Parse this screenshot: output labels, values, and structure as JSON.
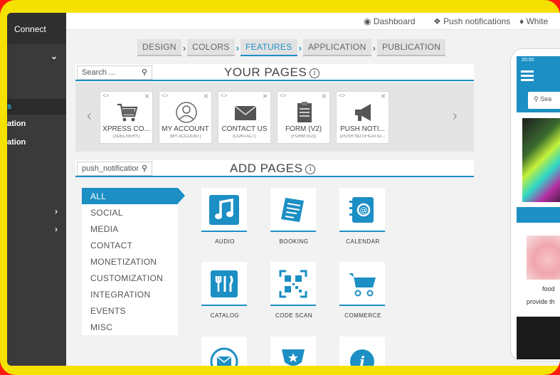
{
  "sidebar": {
    "brand": "Connect",
    "items": [
      "s",
      "ation",
      "ation"
    ]
  },
  "topbar": {
    "dashboard": "Dashboard",
    "push": "Push notifications",
    "white": "White"
  },
  "steps": [
    "DESIGN",
    "COLORS",
    "FEATURES",
    "APPLICATION",
    "PUBLICATION"
  ],
  "your_pages": {
    "title": "YOUR PAGES",
    "search_placeholder": "Search ...",
    "cards": [
      {
        "name": "XPRESS CO...",
        "sub": "(XDELIVERY)",
        "icon": "cart-icon"
      },
      {
        "name": "MY ACCOUNT",
        "sub": "(MY ACCOUNT)",
        "icon": "user-icon"
      },
      {
        "name": "CONTACT US",
        "sub": "(CONTACT)",
        "icon": "envelope-icon"
      },
      {
        "name": "FORM (V2)",
        "sub": "(FORM (V2))",
        "icon": "clipboard-icon"
      },
      {
        "name": "PUSH NOTI...",
        "sub": "(PUSH NOTIFICATIO...",
        "icon": "megaphone-icon"
      }
    ]
  },
  "add_pages": {
    "title": "ADD PAGES",
    "search_value": "push_notification",
    "categories": [
      "ALL",
      "SOCIAL",
      "MEDIA",
      "CONTACT",
      "MONETIZATION",
      "CUSTOMIZATION",
      "INTEGRATION",
      "EVENTS",
      "MISC"
    ],
    "tiles": [
      {
        "label": "AUDIO",
        "icon": "music-note-icon"
      },
      {
        "label": "BOOKING",
        "icon": "booking-icon"
      },
      {
        "label": "CALENDAR",
        "icon": "calendar-icon"
      },
      {
        "label": "CATALOG",
        "icon": "cutlery-icon"
      },
      {
        "label": "CODE SCAN",
        "icon": "qr-code-icon"
      },
      {
        "label": "COMMERCE",
        "icon": "cart-icon"
      },
      {
        "label": "",
        "icon": "envelope-icon"
      },
      {
        "label": "",
        "icon": "trophy-icon"
      },
      {
        "label": "",
        "icon": "info-icon"
      }
    ]
  },
  "phone": {
    "time": "20:50",
    "search": "Sea",
    "text1": "food",
    "text2": "provide th"
  },
  "colors": {
    "accent": "#1c8fc4",
    "sidebar": "#3a3a3a",
    "frame": "#f5e100",
    "border": "#ff1a10"
  }
}
